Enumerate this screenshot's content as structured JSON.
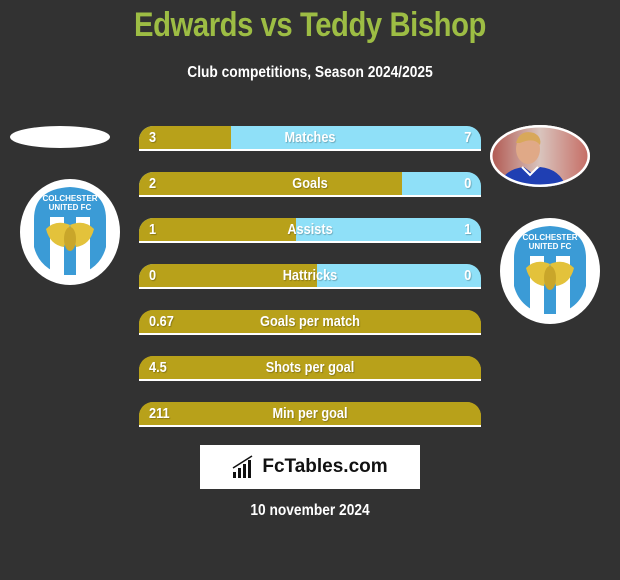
{
  "header": {
    "title": "Edwards vs Teddy Bishop",
    "subtitle": "Club competitions, Season 2024/2025"
  },
  "players": {
    "left": {
      "name": "Edwards",
      "club": "Colchester United FC",
      "badge_text_line1": "COLCHESTER",
      "badge_text_line2": "UNITED FC"
    },
    "right": {
      "name": "Teddy Bishop",
      "club": "Colchester United FC",
      "badge_text_line1": "COLCHESTER",
      "badge_text_line2": "UNITED FC"
    }
  },
  "colors": {
    "left_bar": "#b8a11a",
    "right_bar": "#8fe0f8",
    "title": "#9dbd44",
    "background": "#323232"
  },
  "stats": [
    {
      "label": "Matches",
      "left": "3",
      "right": "7",
      "left_share": 0.27
    },
    {
      "label": "Goals",
      "left": "2",
      "right": "0",
      "left_share": 0.77
    },
    {
      "label": "Assists",
      "left": "1",
      "right": "1",
      "left_share": 0.46
    },
    {
      "label": "Hattricks",
      "left": "0",
      "right": "0",
      "left_share": 0.52
    },
    {
      "label": "Goals per match",
      "left": "0.67",
      "right": null,
      "left_share": 1
    },
    {
      "label": "Shots per goal",
      "left": "4.5",
      "right": null,
      "left_share": 1
    },
    {
      "label": "Min per goal",
      "left": "211",
      "right": null,
      "left_share": 1
    }
  ],
  "footer": {
    "logo_text": "FcTables.com",
    "date": "10 november 2024"
  }
}
